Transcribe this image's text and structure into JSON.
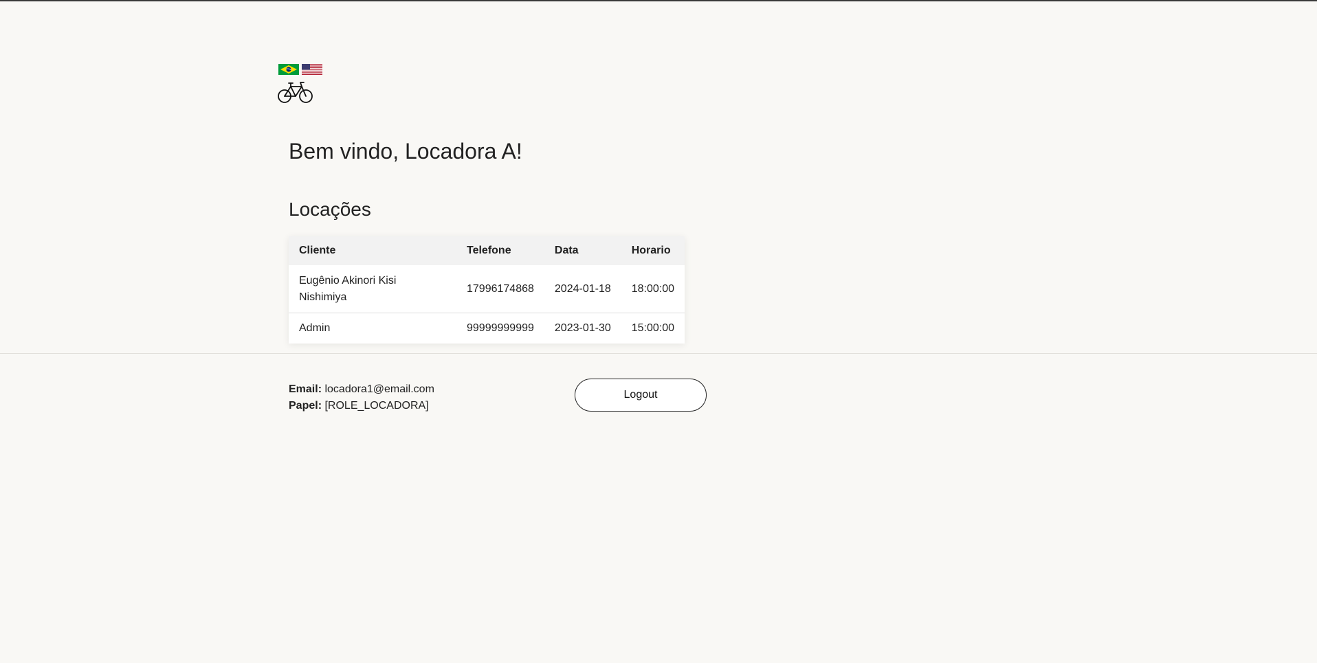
{
  "header": {
    "languages": [
      {
        "name": "Português",
        "flag": "brazil-flag"
      },
      {
        "name": "English",
        "flag": "usa-flag"
      }
    ],
    "logo_icon": "bicycle-icon"
  },
  "main": {
    "welcome": "Bem vindo, Locadora A!",
    "section_title": "Locações",
    "table": {
      "headers": [
        "Cliente",
        "Telefone",
        "Data",
        "Horario"
      ],
      "rows": [
        [
          "Eugênio Akinori Kisi Nishimiya",
          "17996174868",
          "2024-01-18",
          "18:00:00"
        ],
        [
          "Admin",
          "99999999999",
          "2023-01-30",
          "15:00:00"
        ]
      ]
    }
  },
  "footer": {
    "email_label": "Email:",
    "email_value": "locadora1@email.com",
    "role_label": "Papel:",
    "role_value": "[ROLE_LOCADORA]",
    "logout_label": "Logout"
  },
  "colors": {
    "background": "#f9f8f5",
    "table_header": "#f2f2f2",
    "brazil_green": "#009c3b",
    "brazil_yellow": "#ffdf00",
    "usa_red": "#b22234",
    "usa_blue": "#3c3b6e"
  }
}
